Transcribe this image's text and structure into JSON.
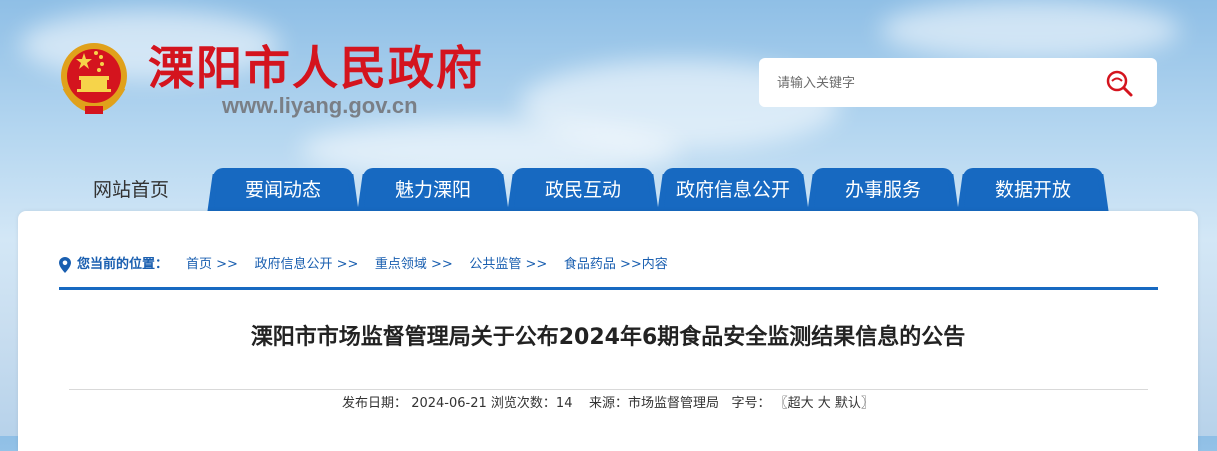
{
  "site": {
    "name": "溧阳市人民政府",
    "url": "www.liyang.gov.cn"
  },
  "search": {
    "placeholder": "请输入关键字"
  },
  "nav": {
    "home": "网站首页",
    "tabs": [
      {
        "label": "要闻动态"
      },
      {
        "label": "魅力溧阳"
      },
      {
        "label": "政民互动"
      },
      {
        "label": "政府信息公开"
      },
      {
        "label": "办事服务"
      },
      {
        "label": "数据开放"
      }
    ]
  },
  "breadcrumb": {
    "label": "您当前的位置：",
    "items": [
      "首页 >>",
      "政府信息公开 >>",
      "重点领域 >>",
      "公共监管 >>",
      "食品药品 >>内容"
    ]
  },
  "article": {
    "title": "溧阳市市场监督管理局关于公布2024年6期食品安全监测结果信息的公告",
    "meta": {
      "date_label": "发布日期：",
      "date": "2024-06-21",
      "views_label": "浏览次数：",
      "views": "14",
      "source_label": "来源：",
      "source": "市场监督管理局",
      "font_label": "字号：",
      "font_open": "〖",
      "font_xl": "超大",
      "font_l": "大",
      "font_default": "默认",
      "font_close": "〗"
    }
  },
  "colors": {
    "brand_red": "#d4141e",
    "nav_blue": "#1769c1",
    "link_blue": "#1a5fb0"
  }
}
